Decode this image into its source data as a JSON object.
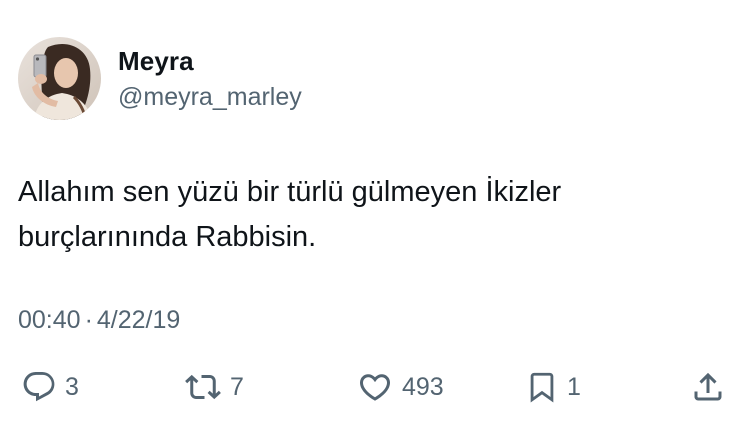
{
  "author": {
    "display_name": "Meyra",
    "handle": "@meyra_marley",
    "avatar_icon": "profile-photo"
  },
  "tweet": {
    "text_lines": [
      "Allahım sen yüzü bir türlü gülmeyen İkizler",
      "burçlarınında Rabbisin."
    ],
    "time": "00:40",
    "separator": "·",
    "date": "4/22/19"
  },
  "actions": {
    "reply": {
      "icon": "speech-bubble-icon",
      "count": "3"
    },
    "retweet": {
      "icon": "retweet-arrows-icon",
      "count": "7"
    },
    "like": {
      "icon": "heart-icon",
      "count": "493"
    },
    "bookmark": {
      "icon": "bookmark-icon",
      "count": "1"
    },
    "share": {
      "icon": "share-upload-icon"
    }
  },
  "colors": {
    "text_primary": "#0f1419",
    "text_secondary": "#536471",
    "background": "#ffffff"
  }
}
